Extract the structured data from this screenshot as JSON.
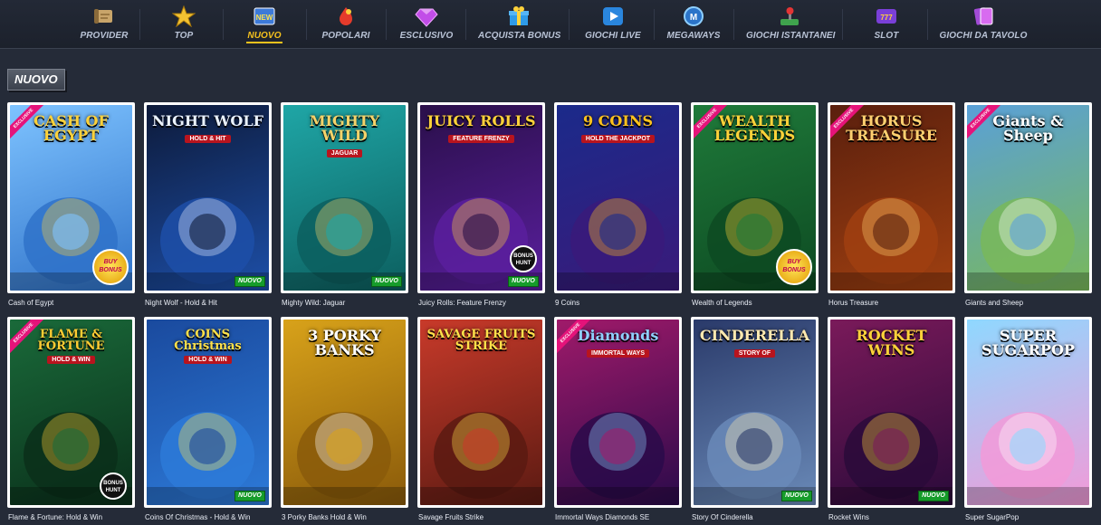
{
  "nav": {
    "items": [
      {
        "label": "PROVIDER",
        "icon": "scroll-icon"
      },
      {
        "label": "TOP",
        "icon": "star-icon"
      },
      {
        "label": "NUOVO",
        "icon": "new-badge-icon",
        "active": true
      },
      {
        "label": "POPOLARI",
        "icon": "fire-gem-icon"
      },
      {
        "label": "ESCLUSIVO",
        "icon": "diamond-icon"
      },
      {
        "label": "ACQUISTA BONUS",
        "icon": "gift-icon"
      },
      {
        "label": "GIOCHI LIVE",
        "icon": "play-icon"
      },
      {
        "label": "MEGAWAYS",
        "icon": "megaways-icon"
      },
      {
        "label": "GIOCHI ISTANTANEI",
        "icon": "joystick-icon"
      },
      {
        "label": "SLOT",
        "icon": "slot-777-icon"
      },
      {
        "label": "GIOCHI DA TAVOLO",
        "icon": "cards-icon"
      }
    ]
  },
  "section": {
    "title": "NUOVO"
  },
  "badges": {
    "new": "NUOVO",
    "exclusive": "Exclusive",
    "bonus": "BUY BONUS",
    "hunt": "BONUS HUNT"
  },
  "games": [
    {
      "name": "Cash of Egypt",
      "art_title": "CASH OF EGYPT",
      "exclusive": true,
      "new": false,
      "promo": "bonus"
    },
    {
      "name": "Night Wolf - Hold & Hit",
      "art_title": "NIGHT WOLF",
      "art_sub": "HOLD & HIT",
      "exclusive": false,
      "new": true
    },
    {
      "name": "Mighty Wild: Jaguar",
      "art_title": "MIGHTY WILD",
      "art_sub": "JAGUAR",
      "exclusive": false,
      "new": true
    },
    {
      "name": "Juicy Rolls: Feature Frenzy",
      "art_title": "JUICY ROLLS",
      "art_sub": "FEATURE FRENZY",
      "exclusive": false,
      "new": true,
      "promo": "hunt"
    },
    {
      "name": "9 Coins",
      "art_title": "9 COINS",
      "art_sub": "HOLD THE JACKPOT",
      "exclusive": false,
      "new": false
    },
    {
      "name": "Wealth of Legends",
      "art_title": "WEALTH LEGENDS",
      "exclusive": true,
      "new": false,
      "promo": "bonus"
    },
    {
      "name": "Horus Treasure",
      "art_title": "HORUS TREASURE",
      "exclusive": true,
      "new": false
    },
    {
      "name": "Giants and Sheep",
      "art_title": "Giants & Sheep",
      "exclusive": true,
      "new": false
    },
    {
      "name": "Flame & Fortune: Hold & Win",
      "art_title": "FLAME & FORTUNE",
      "art_sub": "HOLD & WIN",
      "exclusive": true,
      "new": false,
      "promo": "hunt"
    },
    {
      "name": "Coins Of Christmas - Hold & Win",
      "art_title": "COINS Christmas",
      "art_sub": "HOLD & WIN",
      "exclusive": false,
      "new": true
    },
    {
      "name": "3 Porky Banks Hold & Win",
      "art_title": "3 PORKY BANKS",
      "exclusive": false,
      "new": false
    },
    {
      "name": "Savage Fruits Strike",
      "art_title": "SAVAGE FRUITS STRIKE",
      "exclusive": false,
      "new": false
    },
    {
      "name": "Immortal Ways Diamonds SE",
      "art_title": "Diamonds",
      "art_sub": "IMMORTAL WAYS",
      "exclusive": true,
      "new": false
    },
    {
      "name": "Story Of Cinderella",
      "art_title": "CINDERELLA",
      "art_sub": "STORY OF",
      "exclusive": false,
      "new": true
    },
    {
      "name": "Rocket Wins",
      "art_title": "ROCKET WINS",
      "exclusive": false,
      "new": true
    },
    {
      "name": "Super SugarPop",
      "art_title": "SUPER SUGARPOP",
      "exclusive": false,
      "new": false
    }
  ]
}
